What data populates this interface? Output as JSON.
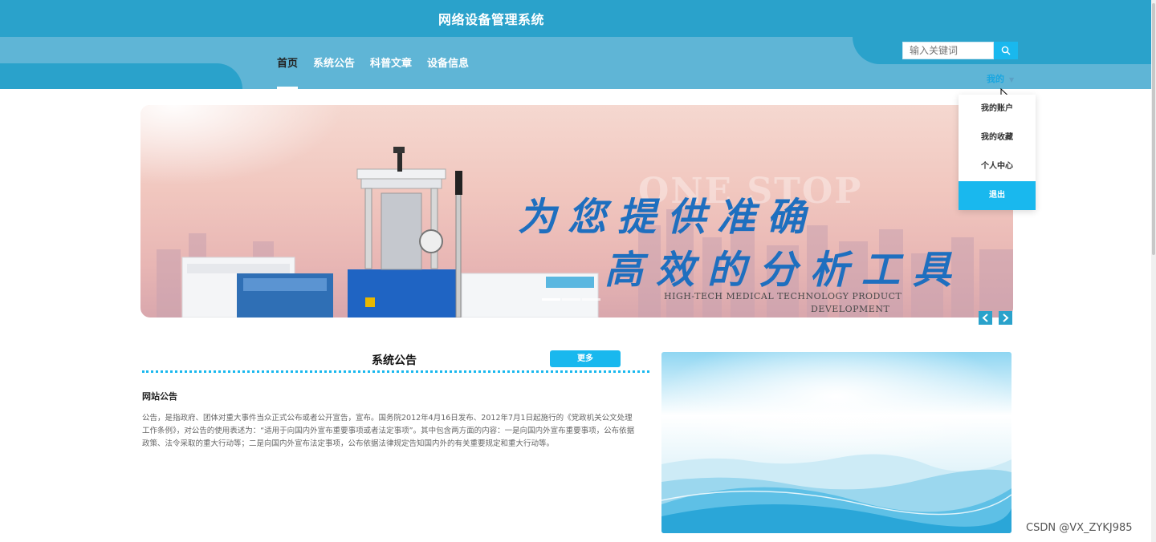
{
  "header": {
    "site_title": "网络设备管理系统",
    "nav": [
      "首页",
      "系统公告",
      "科普文章",
      "设备信息"
    ],
    "search": {
      "placeholder": "输入关键词"
    },
    "user_menu": "我的",
    "dropdown": [
      "我的账户",
      "我的收藏",
      "个人中心",
      "退出"
    ]
  },
  "banner": {
    "watermark": "ONE STOP",
    "line1": "为您提供准确",
    "line2": "高效的分析工具",
    "en_line1": "HIGH-TECH MEDICAL TECHNOLOGY PRODUCT",
    "en_line2": "DEVELOPMENT"
  },
  "notice": {
    "title": "系统公告",
    "more": "更多",
    "article_title": "网站公告",
    "article_body": "公告，是指政府、团体对重大事件当众正式公布或者公开宣告，宣布。国务院2012年4月16日发布、2012年7月1日起施行的《党政机关公文处理工作条例》，对公告的使用表述为：“适用于向国内外宣布重要事项或者法定事项”。其中包含两方面的内容：一是向国内外宣布重要事项，公布依据政策、法令采取的重大行动等；二是向国内外宣布法定事项，公布依据法律规定告知国内外的有关重要规定和重大行动等。"
  },
  "watermark_text": "CSDN @VX_ZYKJ985",
  "colors": {
    "header_dark": "#2aa2cb",
    "header_light": "#5fb5d6",
    "accent": "#19b8ee"
  }
}
